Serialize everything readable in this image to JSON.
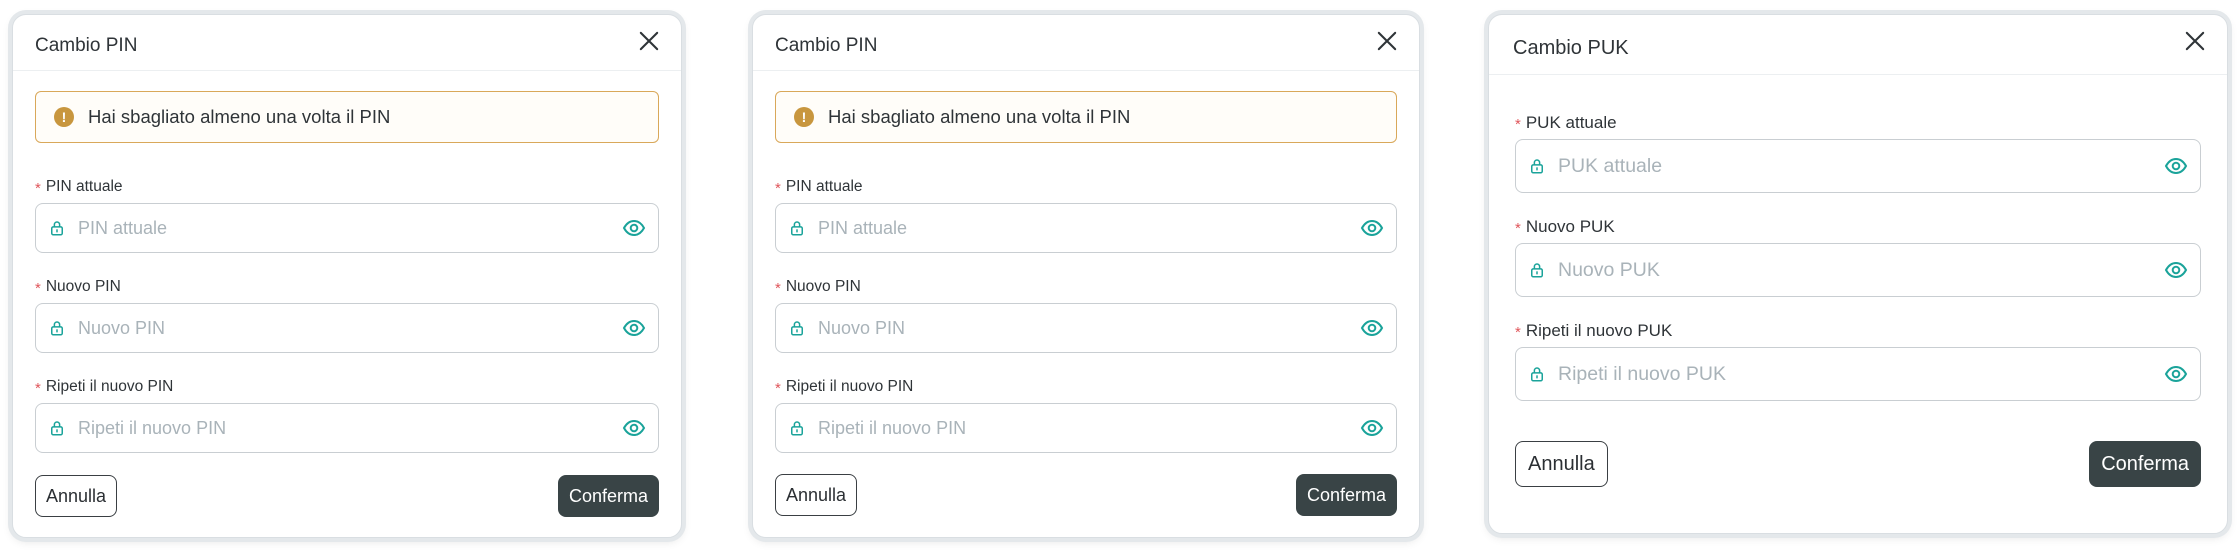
{
  "colors": {
    "accent_teal": "#1aa39a",
    "warning_border": "#d9a85a",
    "warning_icon": "#c8963e",
    "required_asterisk": "#e0565b",
    "confirm_button": "#394446"
  },
  "icons": {
    "close": "close-icon",
    "warning": "exclamation-circle-icon",
    "lock": "lock-icon",
    "eye": "eye-icon"
  },
  "dialogs": [
    {
      "title": "Cambio PIN",
      "alert": {
        "icon_text": "!",
        "text": "Hai sbagliato almeno una volta il PIN"
      },
      "fields": [
        {
          "required_mark": "*",
          "label": "PIN attuale",
          "placeholder": "PIN attuale",
          "value": ""
        },
        {
          "required_mark": "*",
          "label": "Nuovo PIN",
          "placeholder": "Nuovo PIN",
          "value": ""
        },
        {
          "required_mark": "*",
          "label": "Ripeti il nuovo PIN",
          "placeholder": "Ripeti il nuovo PIN",
          "value": ""
        }
      ],
      "cancel_label": "Annulla",
      "confirm_label": "Conferma"
    },
    {
      "title": "Cambio PIN",
      "alert": {
        "icon_text": "!",
        "text": "Hai sbagliato almeno una volta il PIN"
      },
      "fields": [
        {
          "required_mark": "*",
          "label": "PIN attuale",
          "placeholder": "PIN attuale",
          "value": ""
        },
        {
          "required_mark": "*",
          "label": "Nuovo PIN",
          "placeholder": "Nuovo PIN",
          "value": ""
        },
        {
          "required_mark": "*",
          "label": "Ripeti il nuovo PIN",
          "placeholder": "Ripeti il nuovo PIN",
          "value": ""
        }
      ],
      "cancel_label": "Annulla",
      "confirm_label": "Conferma"
    },
    {
      "title": "Cambio PUK",
      "fields": [
        {
          "required_mark": "*",
          "label": "PUK attuale",
          "placeholder": "PUK attuale",
          "value": ""
        },
        {
          "required_mark": "*",
          "label": "Nuovo PUK",
          "placeholder": "Nuovo PUK",
          "value": ""
        },
        {
          "required_mark": "*",
          "label": "Ripeti il nuovo PUK",
          "placeholder": "Ripeti il nuovo PUK",
          "value": ""
        }
      ],
      "cancel_label": "Annulla",
      "confirm_label": "Conferma"
    }
  ]
}
